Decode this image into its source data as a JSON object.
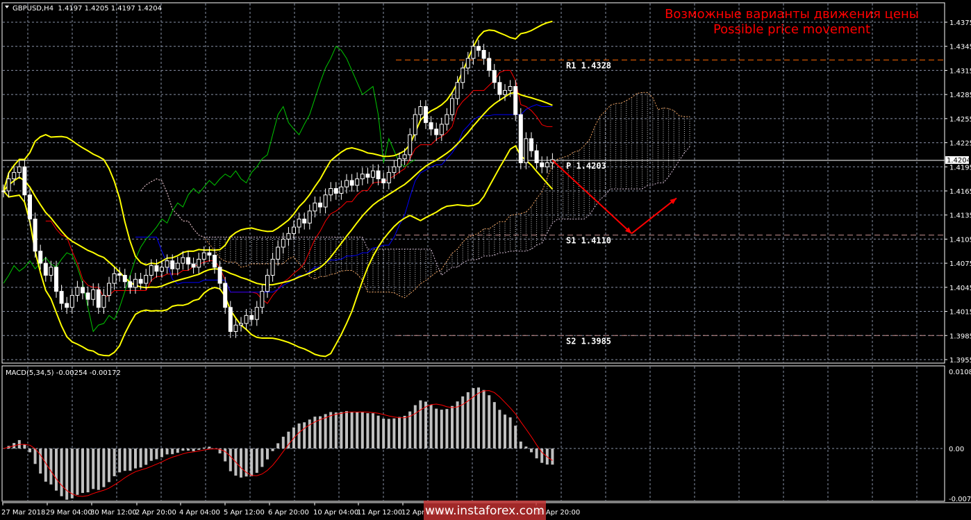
{
  "header": {
    "symbol_info": "GBPUSD,H4  1.4197 1.4205 1.4197 1.4204",
    "menu_icon": "triangle-down-icon"
  },
  "annotation": {
    "line1": "Возможные варианты движения цены",
    "line2": "Possible price movement",
    "color": "#ff0000"
  },
  "watermark": "www.instaforex.com",
  "chart_data": [
    {
      "type": "candlestick",
      "title": "GBPUSD,H4",
      "ylim": [
        1.3955,
        1.4375
      ],
      "y_ticks": [
        "1.4375",
        "1.4345",
        "1.4315",
        "1.4285",
        "1.4255",
        "1.4225",
        "1.4195",
        "1.4165",
        "1.4135",
        "1.4105",
        "1.4075",
        "1.4045",
        "1.4015",
        "1.3985",
        "1.3955"
      ],
      "x_ticks": [
        "27 Mar 2018",
        "29 Mar 04:00",
        "30 Mar 12:00",
        "2 Apr 20:00",
        "4 Apr 04:00",
        "5 Apr 12:00",
        "6 Apr 20:00",
        "10 Apr 04:00",
        "11 Apr 12:00",
        "12 Apr 20:00",
        "18 Apr 20:00"
      ],
      "current_price": "1.4204",
      "grid": true,
      "close": [
        1.4165,
        1.418,
        1.4188,
        1.4195,
        1.416,
        1.413,
        1.409,
        1.4075,
        1.406,
        1.407,
        1.404,
        1.4025,
        1.402,
        1.4035,
        1.4045,
        1.4038,
        1.403,
        1.4042,
        1.402,
        1.4035,
        1.405,
        1.4062,
        1.406,
        1.4052,
        1.4045,
        1.4055,
        1.405,
        1.406,
        1.4072,
        1.4065,
        1.407,
        1.4078,
        1.4068,
        1.4075,
        1.4082,
        1.4074,
        1.407,
        1.408,
        1.4088,
        1.4085,
        1.407,
        1.405,
        1.402,
        1.399,
        1.3998,
        1.4,
        1.401,
        1.4005,
        1.402,
        1.404,
        1.406,
        1.408,
        1.4095,
        1.4105,
        1.4112,
        1.412,
        1.413,
        1.4125,
        1.414,
        1.415,
        1.4145,
        1.416,
        1.4168,
        1.4162,
        1.417,
        1.4178,
        1.4172,
        1.418,
        1.4186,
        1.4182,
        1.419,
        1.418,
        1.4175,
        1.4188,
        1.4195,
        1.4205,
        1.421,
        1.4235,
        1.426,
        1.427,
        1.425,
        1.4242,
        1.4235,
        1.4248,
        1.426,
        1.428,
        1.43,
        1.4318,
        1.433,
        1.4345,
        1.434,
        1.433,
        1.4315,
        1.43,
        1.4285,
        1.429,
        1.4295,
        1.426,
        1.42,
        1.423,
        1.4215,
        1.42,
        1.4195,
        1.42,
        1.4204
      ],
      "indicators": {
        "bollinger": {
          "period": 20,
          "deviation": 2,
          "color": "#ffff00"
        },
        "ichimoku": {
          "tenkan": 9,
          "kijun": 26,
          "senkou_b": 52,
          "tenkan_color": "#ff0000",
          "kijun_color": "#0000ff",
          "chikou_color": "#00c800",
          "span_a_color": "#f4a460",
          "span_b_color": "#d8bfd8"
        }
      },
      "pivots": [
        {
          "label": "R1 1.4328",
          "value": 1.4328,
          "color": "#ff6a00"
        },
        {
          "label": "P 1.4203",
          "value": 1.4203,
          "color": "#ffffff"
        },
        {
          "label": "S1 1.4110",
          "value": 1.411,
          "color": "#c89090"
        },
        {
          "label": "S2 1.3985",
          "value": 1.3985,
          "color": "#c89090"
        }
      ],
      "forecast_path": {
        "bars": [
          104,
          119,
          127.5
        ],
        "prices": [
          1.4203,
          1.4112,
          1.4156
        ],
        "color": "#ff0000"
      }
    },
    {
      "type": "bar+line",
      "title": "MACD(5,34,5) -0.00254 -0.00172",
      "params": [
        5,
        34,
        5
      ],
      "ylim": [
        -0.00742,
        0.01083
      ],
      "y_ticks": [
        "0.01083",
        "0.00",
        "-0.00742"
      ],
      "histogram_color": "#c0c0c0",
      "signal_color": "#ff0000"
    }
  ]
}
